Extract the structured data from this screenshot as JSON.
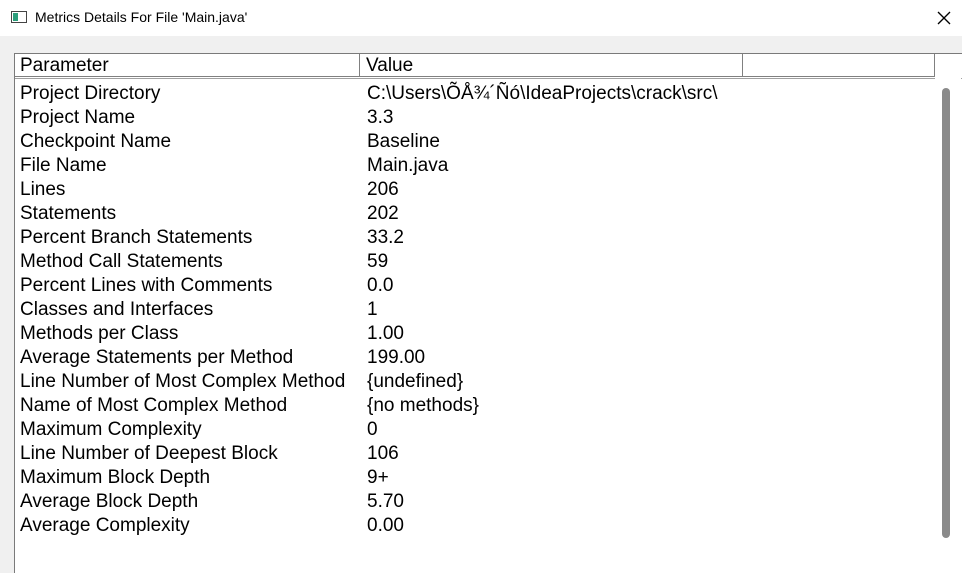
{
  "window": {
    "title": "Metrics Details For File 'Main.java'"
  },
  "table": {
    "headers": {
      "parameter": "Parameter",
      "value": "Value"
    },
    "rows": [
      {
        "parameter": "Project Directory",
        "value": "C:\\Users\\ÕÅ¾´Ñó\\IdeaProjects\\crack\\src\\"
      },
      {
        "parameter": "Project Name",
        "value": "3.3"
      },
      {
        "parameter": "Checkpoint Name",
        "value": "Baseline"
      },
      {
        "parameter": "File Name",
        "value": "Main.java"
      },
      {
        "parameter": "Lines",
        "value": "206"
      },
      {
        "parameter": "Statements",
        "value": "202"
      },
      {
        "parameter": "Percent Branch Statements",
        "value": "33.2"
      },
      {
        "parameter": "Method Call Statements",
        "value": "59"
      },
      {
        "parameter": "Percent Lines with Comments",
        "value": "0.0"
      },
      {
        "parameter": "Classes and Interfaces",
        "value": "1"
      },
      {
        "parameter": "Methods per Class",
        "value": "1.00"
      },
      {
        "parameter": "Average Statements per Method",
        "value": "199.00"
      },
      {
        "parameter": "Line Number of Most Complex Method",
        "value": "{undefined}"
      },
      {
        "parameter": "Name of Most Complex Method",
        "value": "{no methods}"
      },
      {
        "parameter": "Maximum Complexity",
        "value": "0"
      },
      {
        "parameter": "Line Number of Deepest Block",
        "value": "106"
      },
      {
        "parameter": "Maximum Block Depth",
        "value": "9+"
      },
      {
        "parameter": "Average Block Depth",
        "value": "5.70"
      },
      {
        "parameter": "Average Complexity",
        "value": "0.00"
      }
    ]
  },
  "icons": {
    "app": "window-app-icon",
    "close": "close-icon"
  },
  "colors": {
    "titlebar": "#ffffff",
    "background": "#f0f0f0",
    "scroll_thumb": "#8a8a8a"
  }
}
